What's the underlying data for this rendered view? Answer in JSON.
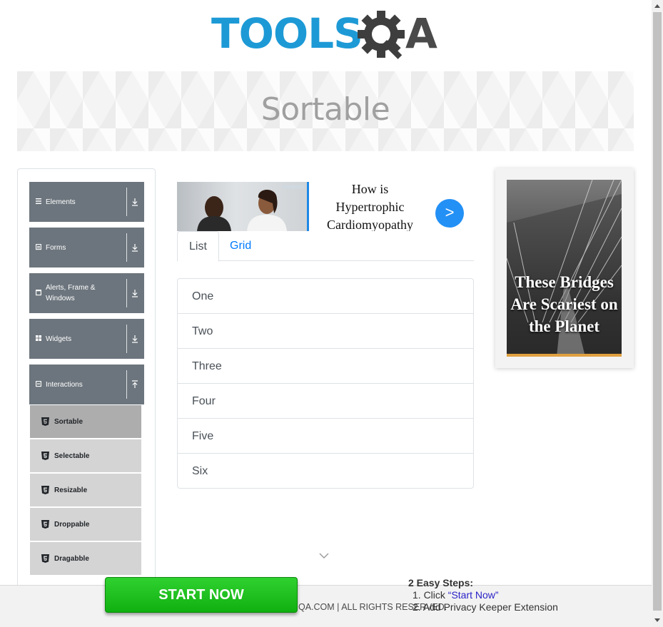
{
  "logo": {
    "part1": "TOOLS",
    "part2": "A"
  },
  "banner": {
    "title": "Sortable"
  },
  "leftnav": {
    "groups": [
      {
        "label": "Elements",
        "icon": "hamburger-icon"
      },
      {
        "label": "Forms",
        "icon": "form-icon"
      },
      {
        "label": "Alerts, Frame & Windows",
        "icon": "window-icon"
      },
      {
        "label": "Widgets",
        "icon": "grid-icon"
      },
      {
        "label": "Interactions",
        "icon": "square-icon"
      }
    ],
    "items": [
      {
        "label": "Sortable"
      },
      {
        "label": "Selectable"
      },
      {
        "label": "Resizable"
      },
      {
        "label": "Droppable"
      },
      {
        "label": "Dragabble"
      }
    ]
  },
  "ad_top": {
    "headline": "How is Hypertrophic Cardiomyopathy Diagnosed?",
    "button": ">"
  },
  "tabs": {
    "list": "List",
    "grid": "Grid"
  },
  "sortable_list": [
    "One",
    "Two",
    "Three",
    "Four",
    "Five",
    "Six"
  ],
  "ad_right": {
    "caption": "These Bridges Are Scariest on the Planet"
  },
  "footer": {
    "copyright": "QA.COM | ALL RIGHTS RESERVED.",
    "steps_title": "2 Easy Steps:",
    "step1_prefix": "1. Click ",
    "step1_link": "“Start Now”",
    "step2": "2. Add Privacy Keeper Extension",
    "start_button": "START NOW"
  },
  "colors": {
    "brand_blue": "#1d9ad6",
    "nav_group": "#6c757d",
    "nav_item": "#d4d4d4",
    "nav_active": "#adadad",
    "start_green": "#10b010"
  }
}
